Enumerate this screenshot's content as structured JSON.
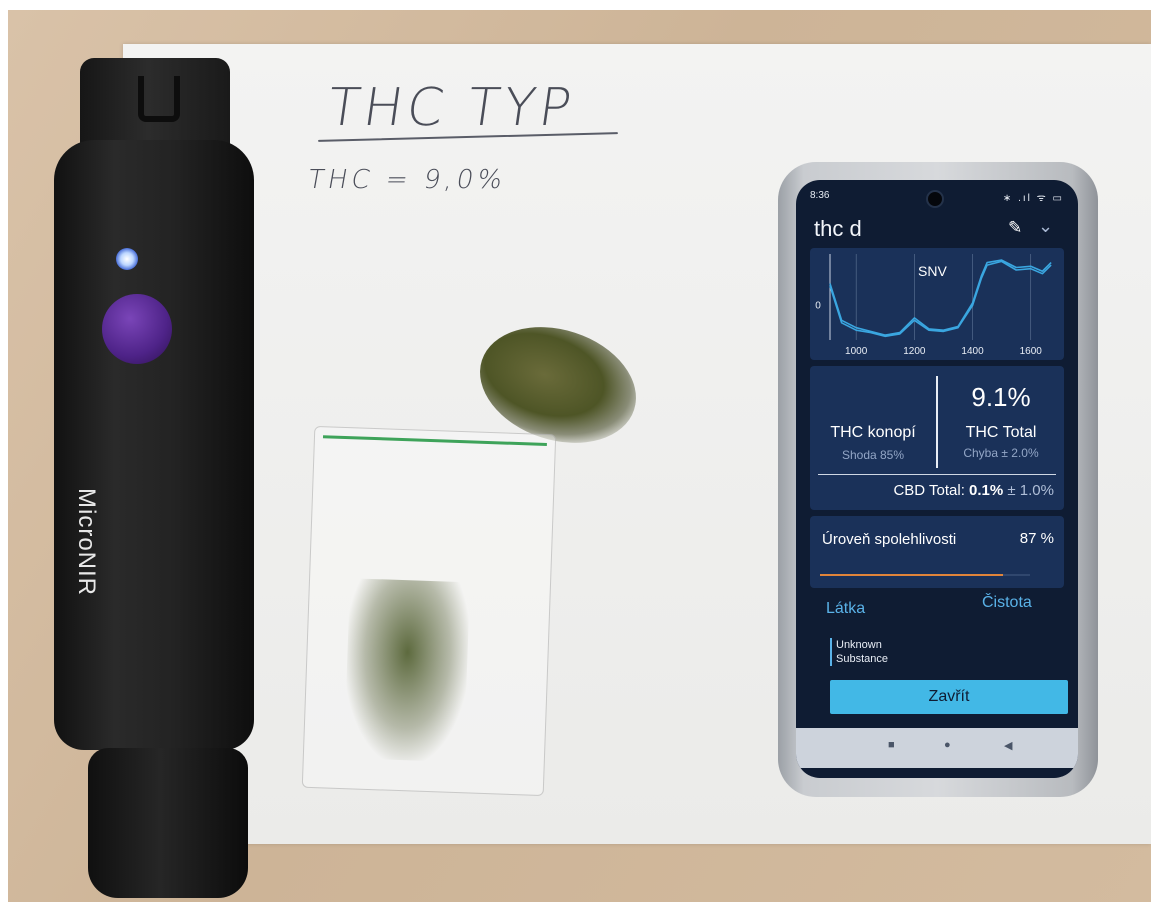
{
  "handwritten_note": {
    "title": "THC TYP",
    "measurement": "THC = 9,0%"
  },
  "device": {
    "label": "MicroNIR",
    "button_color": "#5b2a9a",
    "led_color": "#cfe0ff"
  },
  "phone": {
    "status_time": "8:36",
    "status_icons": "∗ .ıl ᯤ ▭",
    "app_title": "thc d",
    "edit_icon": "pencil-icon",
    "dropdown_icon": "chevron-down-icon",
    "chart_data": {
      "type": "line",
      "title": "SNV",
      "xlabel": "",
      "ylabel": "",
      "x_ticks": [
        "1000",
        "1200",
        "1400",
        "1600"
      ],
      "y_ticks": [
        "0"
      ],
      "xlim": [
        910,
        1680
      ],
      "ylim": [
        -1.4,
        2.1
      ],
      "series": [
        {
          "x": [
            910,
            950,
            1000,
            1050,
            1100,
            1150,
            1200,
            1250,
            1300,
            1350,
            1400,
            1430,
            1450,
            1500,
            1550,
            1600,
            1640,
            1670
          ],
          "values": [
            0.9,
            -0.6,
            -0.9,
            -1.05,
            -1.2,
            -1.1,
            -0.5,
            -0.95,
            -1.0,
            -0.85,
            0.1,
            1.2,
            1.75,
            1.85,
            1.55,
            1.6,
            1.4,
            1.75
          ]
        },
        {
          "x": [
            910,
            950,
            1000,
            1050,
            1100,
            1150,
            1200,
            1250,
            1300,
            1350,
            1400,
            1430,
            1450,
            1500,
            1550,
            1600,
            1640,
            1670
          ],
          "values": [
            0.8,
            -0.7,
            -1.0,
            -1.1,
            -1.25,
            -1.15,
            -0.6,
            -1.0,
            -1.05,
            -0.9,
            0.0,
            1.1,
            1.65,
            1.8,
            1.45,
            1.5,
            1.3,
            1.65
          ]
        }
      ],
      "line_color": "#3aa6e0",
      "grid": true
    },
    "result": {
      "name": "THC konopí",
      "match": "Shoda 85%",
      "value": "9.1%",
      "label": "THC Total",
      "error": "Chyba ± 2.0%",
      "cbd_prefix": "CBD Total: ",
      "cbd_value": "0.1%",
      "cbd_error": " ± 1.0%"
    },
    "reliability": {
      "label": "Úroveň spolehlivosti",
      "value": "87 %",
      "fraction": 0.87,
      "bar_color": "#e0843a"
    },
    "tabs": {
      "substance": "Látka",
      "purity": "Čistota"
    },
    "substance_text": "Unknown Substance",
    "close_label": "Zavřít",
    "nav": {
      "recents": "■",
      "home": "●",
      "back": "◀"
    }
  }
}
